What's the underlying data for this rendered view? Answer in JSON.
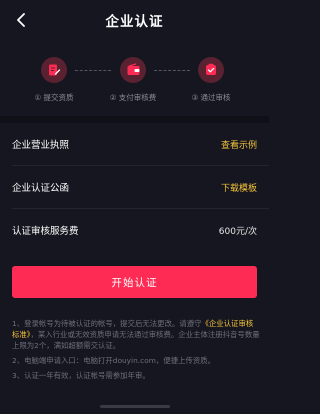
{
  "header": {
    "title": "企业认证",
    "back_icon": "chevron-left-icon"
  },
  "steps": [
    {
      "label": "① 提交资质",
      "icon": "document-edit-icon"
    },
    {
      "label": "② 支付审核费",
      "icon": "wallet-icon"
    },
    {
      "label": "③ 通过审核",
      "icon": "badge-check-icon"
    }
  ],
  "rows": {
    "license": {
      "label": "企业营业执照",
      "action": "查看示例"
    },
    "letter": {
      "label": "企业认证公函",
      "action": "下载模板"
    },
    "fee": {
      "label": "认证审核服务费",
      "value": "600元/次"
    }
  },
  "start_button": "开始认证",
  "notes": {
    "n1_before": "1、登录帐号为待被认证的帐号，提交后无法更改。请遵守",
    "n1_link": "《企业认证审核标准》",
    "n1_after": "，某入行业或无效资质申请无法通过审核费。企业主体注册抖音号数量上限为2个，满如超额需交认证。",
    "n2": "2、电脑端申请入口：电脑打开douyin.com，便捷上传资质。",
    "n3": "3、认证一年有效，认证帐号需参加年审。"
  },
  "colors": {
    "background": "#15161f",
    "accent": "#fe2c55",
    "link": "#f5c33b",
    "step_circle": "#5a2230"
  }
}
